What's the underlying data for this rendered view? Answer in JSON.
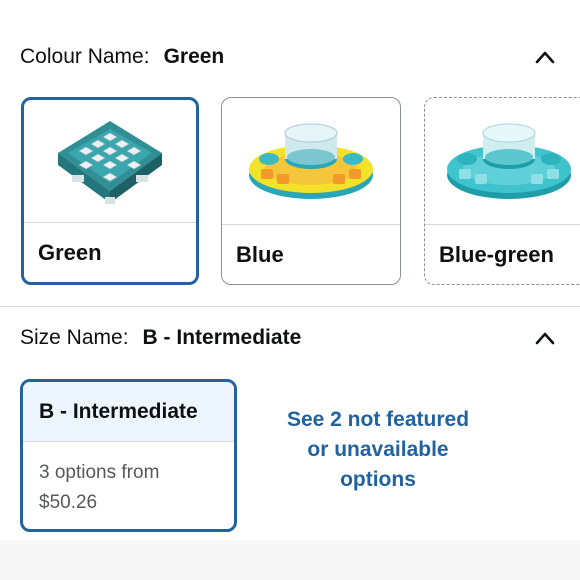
{
  "colour": {
    "label": "Colour Name:",
    "selected": "Green",
    "options": [
      {
        "label": "Green",
        "image": "puzzle-board-toy"
      },
      {
        "label": "Blue",
        "image": "spinner-bowl-toy-yellow"
      },
      {
        "label": "Blue-green",
        "image": "spinner-bowl-toy-teal"
      }
    ]
  },
  "size": {
    "label": "Size Name:",
    "selected": "B - Intermediate",
    "card": {
      "title": "B - Intermediate",
      "line1": "3 options from",
      "line2": "$50.26"
    },
    "see_more_lines": [
      "See 2 not featured",
      "or unavailable",
      "options"
    ]
  },
  "icons": {
    "collapse": "chevron-up-icon"
  },
  "colors": {
    "accent": "#2162a1",
    "selected_bg": "#edf6ff",
    "border": "#d5d9d9"
  }
}
